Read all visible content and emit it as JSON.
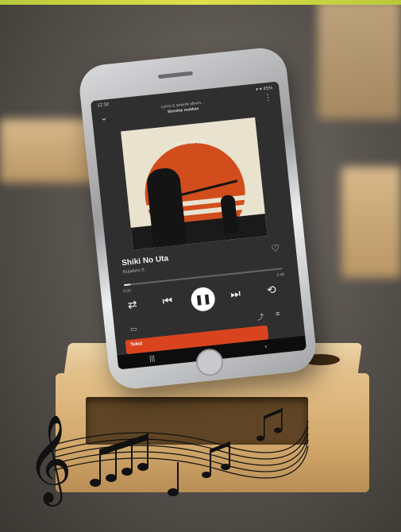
{
  "player": {
    "status_time": "12:32",
    "status_icons": "▾ ▾ 45%",
    "header_line1": "Lyrics & artwork album...",
    "header_line2": "Shoshie mokkes",
    "cover_title": "Shiki No Uta",
    "song_title": "Shiki No Uta",
    "song_artist": "Nujabes ft.",
    "time_elapsed": "0:00",
    "time_total": "3:48",
    "progress": 0.04,
    "lyrics_label": "Tekst",
    "accent": "#d9441f"
  },
  "icons": {
    "chevron": "chevron-down-icon",
    "menu": "more-vertical-icon",
    "heart": "heart-icon",
    "shuffle": "shuffle-icon",
    "prev": "skip-previous-icon",
    "pause": "pause-icon",
    "next": "skip-next-icon",
    "repeat": "repeat-icon",
    "share": "share-icon",
    "queue": "queue-icon",
    "devices": "devices-icon",
    "treble_clef": "treble-clef-icon"
  }
}
